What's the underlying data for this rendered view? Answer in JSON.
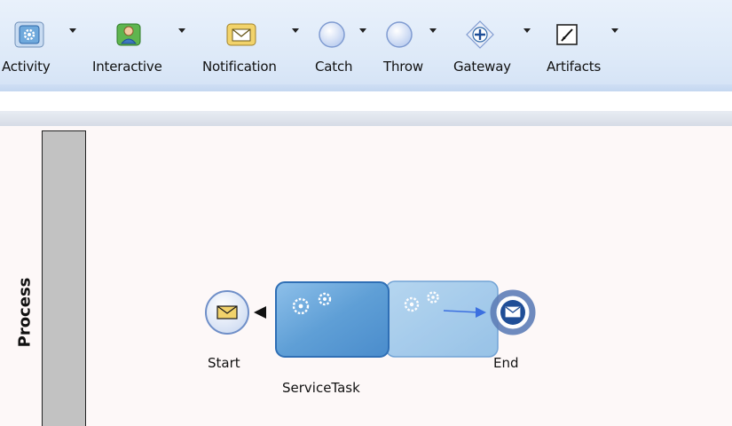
{
  "palette": {
    "items": [
      {
        "label": "Activity",
        "icon": "activity-gear-icon"
      },
      {
        "label": "Interactive",
        "icon": "interactive-user-icon"
      },
      {
        "label": "Notification",
        "icon": "notification-envelope-icon"
      },
      {
        "label": "Catch",
        "icon": "catch-event-circle-icon"
      },
      {
        "label": "Throw",
        "icon": "throw-event-circle-icon"
      },
      {
        "label": "Gateway",
        "icon": "gateway-diamond-icon"
      },
      {
        "label": "Artifacts",
        "icon": "artifacts-annotation-icon"
      }
    ]
  },
  "lane": {
    "label": "Process"
  },
  "diagram": {
    "start_label": "Start",
    "task_label": "ServiceTask",
    "end_label": "End"
  },
  "colors": {
    "toolbar_bg": "#dde9f8",
    "lane_header": "#c2c2c2",
    "canvas_bg": "#fdf8f8",
    "task_fill": "#6fa9dc",
    "event_blue": "#1f4e97"
  }
}
